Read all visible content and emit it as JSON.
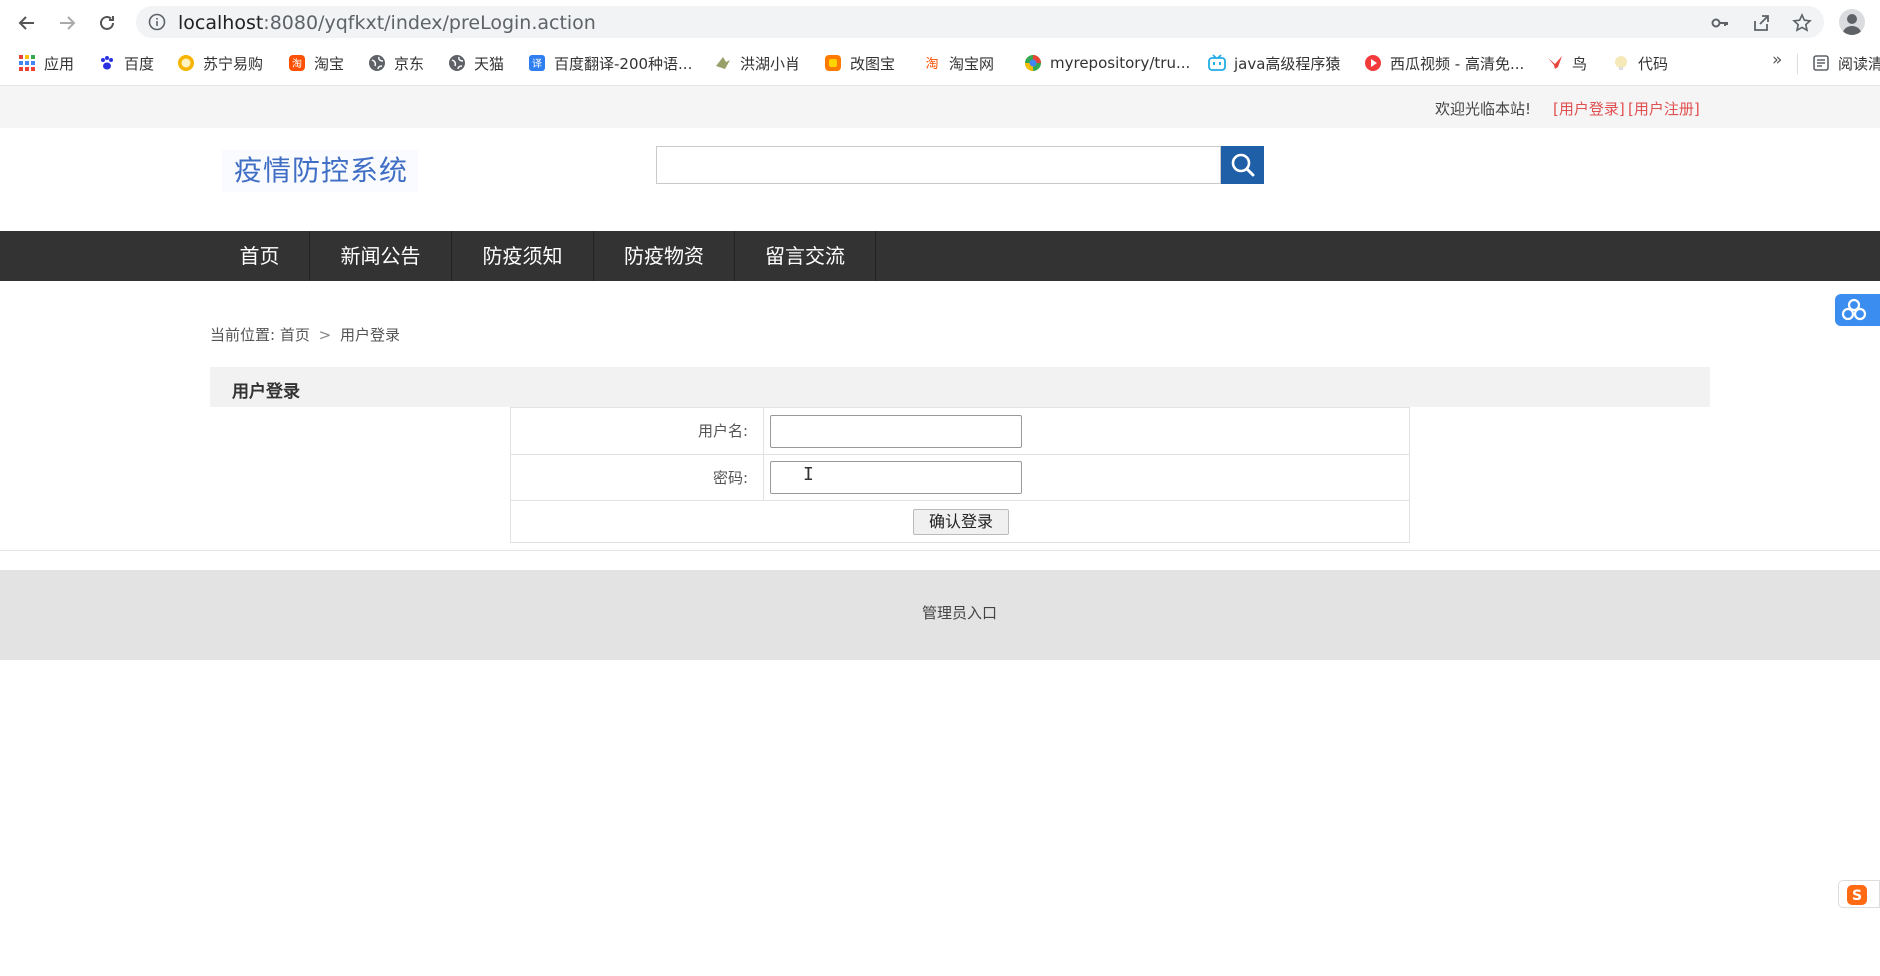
{
  "browser": {
    "url_host": "localhost",
    "url_rest": ":8080/yqfkxt/index/preLogin.action"
  },
  "bookmarks": [
    {
      "label": "应用",
      "icon": "apps-grid-icon"
    },
    {
      "label": "百度",
      "icon": "baidu-paw-icon"
    },
    {
      "label": "苏宁易购",
      "icon": "suning-lion-icon"
    },
    {
      "label": "淘宝",
      "icon": "taobao-icon"
    },
    {
      "label": "京东",
      "icon": "globe-icon"
    },
    {
      "label": "天猫",
      "icon": "globe-icon"
    },
    {
      "label": "百度翻译-200种语...",
      "icon": "translate-icon"
    },
    {
      "label": "洪湖小肖",
      "icon": "bird-icon"
    },
    {
      "label": "改图宝",
      "icon": "gaitubao-icon"
    },
    {
      "label": "淘宝网",
      "icon": "taobao-icon"
    },
    {
      "label": "myrepository/tru...",
      "icon": "colorful-circle-icon"
    },
    {
      "label": "java高级程序猿",
      "icon": "bilibili-tv-icon"
    },
    {
      "label": "西瓜视频 - 高清免...",
      "icon": "play-circle-icon"
    },
    {
      "label": "鸟",
      "icon": "bird-red-icon"
    },
    {
      "label": "代码",
      "icon": "bulb-icon"
    }
  ],
  "bookmarks_more": "»",
  "reading_list": "阅读清",
  "topbar": {
    "welcome": "欢迎光临本站!",
    "login": "[用户登录]",
    "register": "[用户注册]"
  },
  "site": {
    "logo": "疫情防控系统",
    "search_placeholder": ""
  },
  "nav": [
    {
      "label": "首页"
    },
    {
      "label": "新闻公告"
    },
    {
      "label": "防疫须知"
    },
    {
      "label": "防疫物资"
    },
    {
      "label": "留言交流"
    }
  ],
  "breadcrumb": {
    "prefix": "当前位置:",
    "home": "首页",
    "separator": ">",
    "current": "用户登录"
  },
  "login": {
    "title": "用户登录",
    "username_label": "用户名:",
    "username_value": "",
    "password_label": "密码:",
    "password_value": "",
    "submit": "确认登录"
  },
  "footer": {
    "admin": "管理员入口"
  },
  "colors": {
    "nav_bg": "#333333",
    "search_btn": "#1e5fa8",
    "link_red": "#e05050",
    "logo_blue": "#3f6ec4"
  }
}
